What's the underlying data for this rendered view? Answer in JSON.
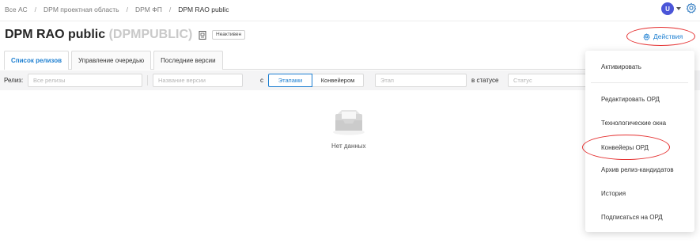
{
  "breadcrumb": {
    "items": [
      "Все АС",
      "DPM проектная область",
      "DPM ФП",
      "DPM RAO public"
    ],
    "separator": "/"
  },
  "header": {
    "avatar_letter": "U",
    "avatar_color": "#4a55d8",
    "settings_icon": "gear-icon"
  },
  "page": {
    "title": "DPM RAO public",
    "code": "(DPMPUBLIC)",
    "status": "Неактивен",
    "actions_label": "Действия",
    "accent_color": "#1d7fd1",
    "highlight_color": "#e53131"
  },
  "tabs": [
    {
      "label": "Список релизов",
      "active": true
    },
    {
      "label": "Управление очередью",
      "active": false
    },
    {
      "label": "Последние версии",
      "active": false
    }
  ],
  "filters": {
    "release_label": "Релиз:",
    "release_placeholder": "Все релизы",
    "version_placeholder": "Название версии",
    "with_label": "с",
    "mode_stages": "Этапами",
    "mode_pipeline": "Конвейером",
    "active_mode": "Этапами",
    "stage_placeholder": "Этап",
    "status_label": "в статусе",
    "status_placeholder": "Статус"
  },
  "empty": {
    "icon": "empty-inbox-icon",
    "text": "Нет данных"
  },
  "actions_menu": {
    "items": [
      "Активировать",
      "Редактировать ОРД",
      "Технологические окна",
      "Конвейеры ОРД",
      "Архив релиз-кандидатов",
      "История",
      "Подписаться на ОРД"
    ]
  }
}
